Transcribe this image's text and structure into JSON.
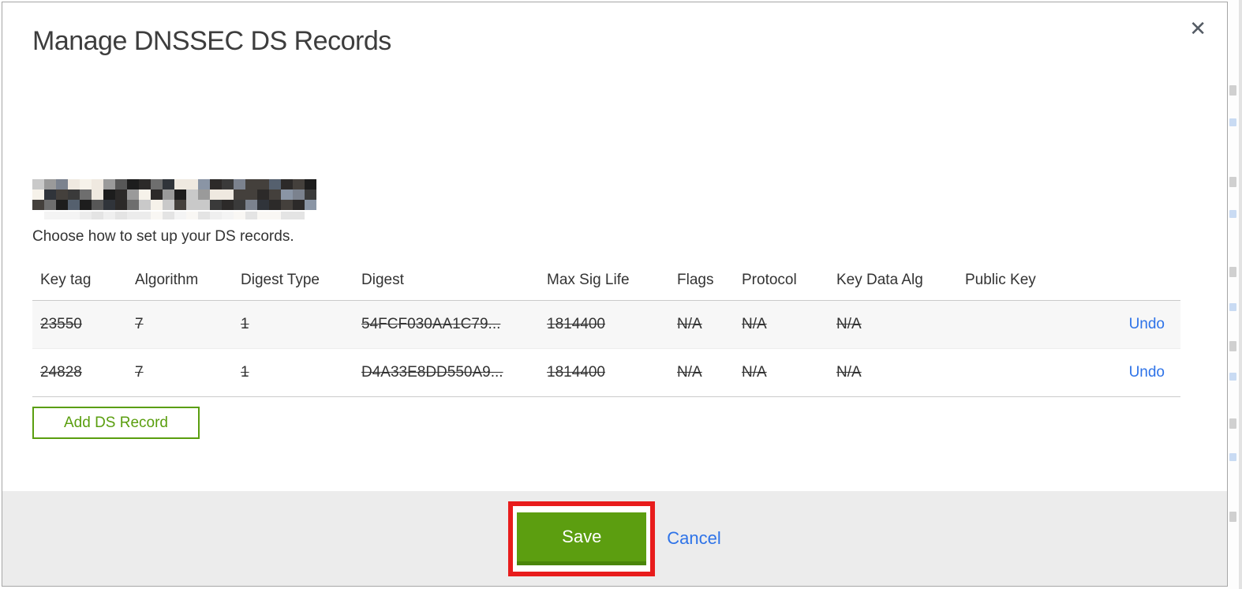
{
  "modal": {
    "title": "Manage DNSSEC DS Records",
    "close_label": "✕",
    "domain_name_redacted": true,
    "subtitle": "Choose how to set up your DS records.",
    "table": {
      "columns": [
        "Key tag",
        "Algorithm",
        "Digest Type",
        "Digest",
        "Max Sig Life",
        "Flags",
        "Protocol",
        "Key Data Alg",
        "Public Key"
      ],
      "rows": [
        {
          "cells": [
            "23550",
            "7",
            "1",
            "54FCF030AA1C79...",
            "1814400",
            "N/A",
            "N/A",
            "N/A",
            ""
          ],
          "action": "Undo",
          "marked_for_deletion": true
        },
        {
          "cells": [
            "24828",
            "7",
            "1",
            "D4A33E8DD550A9...",
            "1814400",
            "N/A",
            "N/A",
            "N/A",
            ""
          ],
          "action": "Undo",
          "marked_for_deletion": true
        }
      ]
    },
    "add_button_label": "Add DS Record",
    "footer": {
      "save_label": "Save",
      "cancel_label": "Cancel"
    }
  },
  "colors": {
    "accent_green": "#5c9e10",
    "outline_green": "#5a9e0f",
    "link_blue": "#2e73e8",
    "footer_gray": "#ececec",
    "row_stripe": "#f7f7f7",
    "annotation_red": "#e81c1c"
  }
}
